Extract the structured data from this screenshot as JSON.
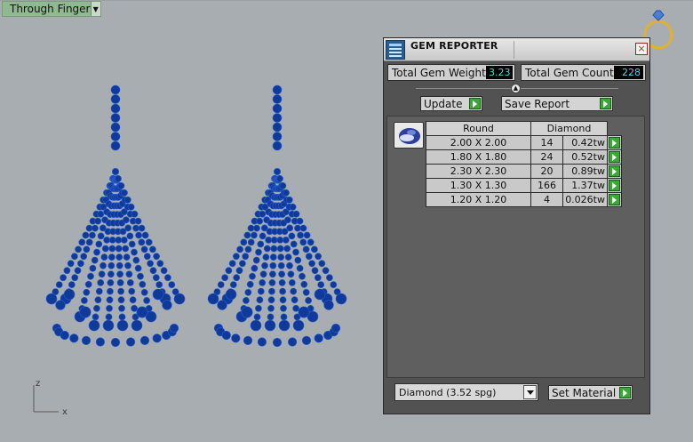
{
  "viewport": {
    "tab_label": "Through Finger",
    "axis": {
      "z_label": "z",
      "x_label": "x"
    }
  },
  "gem_reporter": {
    "title": "GEM REPORTER",
    "close_glyph": "×",
    "total_weight_label": "Total Gem Weight",
    "total_weight_value": "3.23",
    "total_count_label": "Total Gem Count",
    "total_count_value": "228",
    "update_label": "Update",
    "save_report_label": "Save Report",
    "table": {
      "shape_header": "Round",
      "material_header": "Diamond",
      "rows": [
        {
          "size": "2.00 X 2.00",
          "count": "14",
          "weight": "0.42tw"
        },
        {
          "size": "1.80 X 1.80",
          "count": "24",
          "weight": "0.52tw"
        },
        {
          "size": "2.30 X 2.30",
          "count": "20",
          "weight": "0.89tw"
        },
        {
          "size": "1.30 X 1.30",
          "count": "166",
          "weight": "1.37tw"
        },
        {
          "size": "1.20 X 1.20",
          "count": "4",
          "weight": "0.026tw"
        }
      ]
    },
    "material_select_value": "Diamond     (3.52 spg)",
    "set_material_label": "Set Material"
  },
  "colors": {
    "gem_blue": "#0f3a9a",
    "gem_highlight": "#2a5ed0",
    "viewport_bg": "#a8adb2",
    "panel_bg": "#525252",
    "value_text": "#4fd6d6",
    "play_green": "#39a839"
  }
}
